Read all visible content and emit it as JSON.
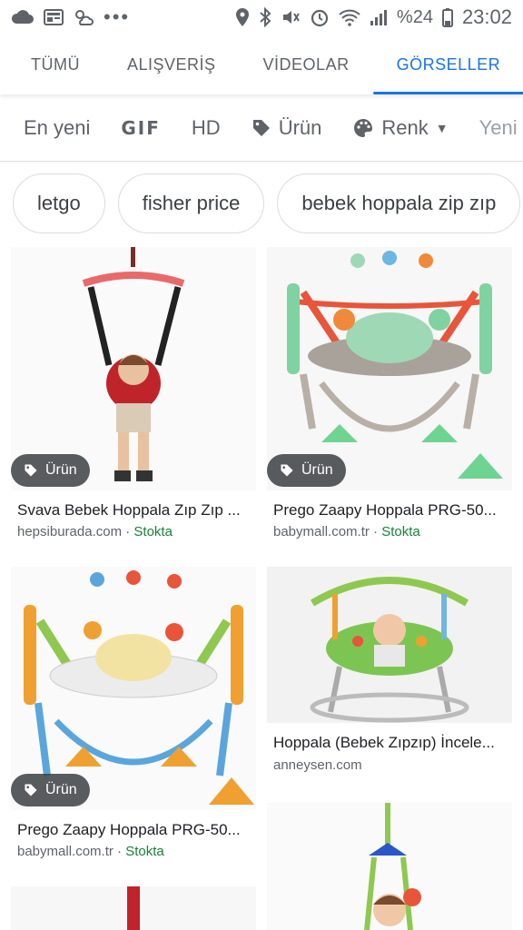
{
  "status_bar": {
    "battery_percent": "%24",
    "time": "23:02"
  },
  "tabs": [
    {
      "label": "TÜMÜ",
      "active": false
    },
    {
      "label": "ALIŞVERİŞ",
      "active": false
    },
    {
      "label": "VİDEOLAR",
      "active": false
    },
    {
      "label": "GÖRSELLER",
      "active": true
    }
  ],
  "filters": {
    "newest": "En yeni",
    "gif": "GIF",
    "hd": "HD",
    "product": "Ürün",
    "color": "Renk",
    "new_partial": "Yeni"
  },
  "chips": [
    "letgo",
    "fisher price",
    "bebek hoppala zip zıp"
  ],
  "results": [
    {
      "title": "Svava Bebek Hoppala Zıp Zıp ...",
      "source": "hepsiburada.com",
      "stock": "Stokta",
      "badge": "Ürün"
    },
    {
      "title": "Prego Zaapy Hoppala PRG-50...",
      "source": "babymall.com.tr",
      "stock": "Stokta",
      "badge": "Ürün"
    },
    {
      "title": "Prego Zaapy Hoppala PRG-50...",
      "source": "babymall.com.tr",
      "stock": "Stokta",
      "badge": "Ürün"
    },
    {
      "title": "Hoppala (Bebek Zıpzıp) İncele...",
      "source": "anneysen.com",
      "stock": "",
      "badge": ""
    }
  ],
  "colors": {
    "accent": "#1a73e8",
    "stock_green": "#188038"
  }
}
